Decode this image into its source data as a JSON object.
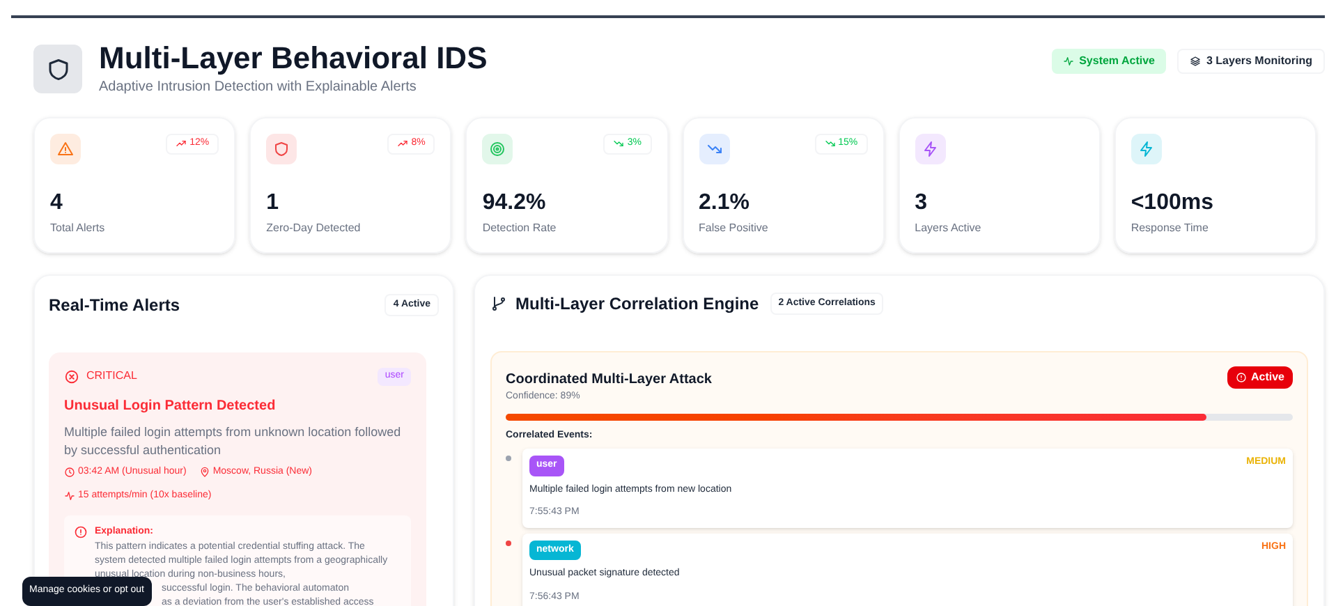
{
  "header": {
    "title": "Multi-Layer Behavioral IDS",
    "subtitle": "Adaptive Intrusion Detection with Explainable Alerts",
    "badges": [
      {
        "kind": "status",
        "label": "System Active"
      },
      {
        "kind": "layers",
        "label": "3 Layers Monitoring"
      }
    ]
  },
  "stats": [
    {
      "kind": "up",
      "color": "#f97316",
      "value": "4",
      "label": "Total Alerts",
      "trend": "12%"
    },
    {
      "kind": "up",
      "color": "#ef4444",
      "value": "1",
      "label": "Zero-Day Detected",
      "trend": "8%"
    },
    {
      "kind": "down",
      "color": "#22c55e",
      "value": "94.2%",
      "label": "Detection Rate",
      "trend": "3%"
    },
    {
      "kind": "down",
      "color": "#3b82f6",
      "value": "2.1%",
      "label": "False Positive",
      "trend": "15%"
    },
    {
      "color": "#a855f7",
      "value": "3",
      "label": "Layers Active"
    },
    {
      "color": "#06b6d4",
      "value": "<100ms",
      "label": "Response Time"
    }
  ],
  "alerts_panel": {
    "title": "Real-Time Alerts",
    "count": "4 Active",
    "alerts": [
      {
        "severity": "CRITICAL",
        "layer": "user",
        "title": "Unusual Login Pattern Detected",
        "description": "Multiple failed login attempts from unknown location followed by successful authentication",
        "time": "03:42 AM (Unusual hour)",
        "location": "Moscow, Russia (New)",
        "rate": "15 attempts/min (10x baseline)",
        "explanation_heading": "Explanation:",
        "explanation": "This pattern indicates a potential credential stuffing attack. The system detected multiple failed login attempts from a geographically unusual location during non-business hours,",
        "explanation_fragments": [
          "successful login. The behavioral automaton",
          "as a deviation from the user's established access"
        ]
      }
    ]
  },
  "correlation_panel": {
    "title": "Multi-Layer Correlation Engine",
    "count": "2 Active Correlations",
    "correlations": [
      {
        "title": "Coordinated Multi-Layer Attack",
        "status": "Active",
        "confidence": "Confidence: 89%",
        "level": 0.89,
        "events_heading": "Correlated Events:",
        "events": [
          {
            "dot": {
              "color": "#9ca3af"
            },
            "layer": {
              "label": "user",
              "color": "#a855f7"
            },
            "severity": {
              "label": "MEDIUM",
              "color": "#eab308"
            },
            "text": "Multiple failed login attempts from new location",
            "time": "7:55:43 PM"
          },
          {
            "dot": {
              "color": "#ef4444"
            },
            "layer": {
              "label": "network",
              "color": "#06b6d4"
            },
            "severity": {
              "label": "HIGH",
              "color": "#f97316"
            },
            "text": "Unusual packet signature detected",
            "time": "7:56:43 PM"
          }
        ]
      }
    ]
  },
  "cookie_notice": "Manage cookies or opt out"
}
